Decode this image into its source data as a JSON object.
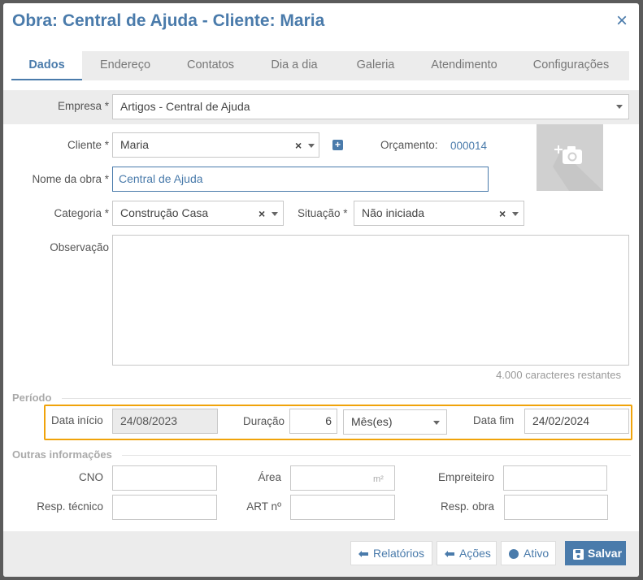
{
  "dialog": {
    "title": "Obra: Central de Ajuda - Cliente: Maria",
    "close_label": "×"
  },
  "tabs": [
    {
      "label": "Dados",
      "active": true
    },
    {
      "label": "Endereço"
    },
    {
      "label": "Contatos"
    },
    {
      "label": "Dia a dia"
    },
    {
      "label": "Galeria"
    },
    {
      "label": "Atendimento"
    },
    {
      "label": "Configurações"
    }
  ],
  "form": {
    "empresa": {
      "label": "Empresa *",
      "value": "Artigos - Central de Ajuda"
    },
    "cliente": {
      "label": "Cliente *",
      "value": "Maria",
      "clear": "×",
      "add": "+"
    },
    "orcamento": {
      "label": "Orçamento:",
      "value": "000014"
    },
    "nome_obra": {
      "label": "Nome da obra *",
      "value": "Central de Ajuda"
    },
    "categoria": {
      "label": "Categoria *",
      "value": "Construção Casa",
      "clear": "×"
    },
    "situacao": {
      "label": "Situação *",
      "value": "Não iniciada",
      "clear": "×"
    },
    "observacao": {
      "label": "Observação",
      "value": "",
      "counter": "4.000  caracteres restantes"
    }
  },
  "periodo": {
    "title": "Período",
    "data_inicio": {
      "label": "Data início",
      "value": "24/08/2023"
    },
    "duracao": {
      "label": "Duração",
      "value": "6",
      "unit": "Mês(es)"
    },
    "data_fim": {
      "label": "Data fim",
      "value": "24/02/2024"
    }
  },
  "outras": {
    "title": "Outras informações",
    "cno": {
      "label": "CNO",
      "value": ""
    },
    "area": {
      "label": "Área",
      "value": "",
      "unit": "m²"
    },
    "empreiteiro": {
      "label": "Empreiteiro",
      "value": ""
    },
    "resp_tecnico": {
      "label": "Resp. técnico",
      "value": ""
    },
    "art": {
      "label": "ART nº",
      "value": ""
    },
    "resp_obra": {
      "label": "Resp. obra",
      "value": ""
    }
  },
  "footer": {
    "relatorios": "Relatórios",
    "acoes": "Ações",
    "ativo": "Ativo",
    "salvar": "Salvar"
  },
  "colors": {
    "accent": "#4a7bab",
    "highlight": "#f0a30a"
  }
}
